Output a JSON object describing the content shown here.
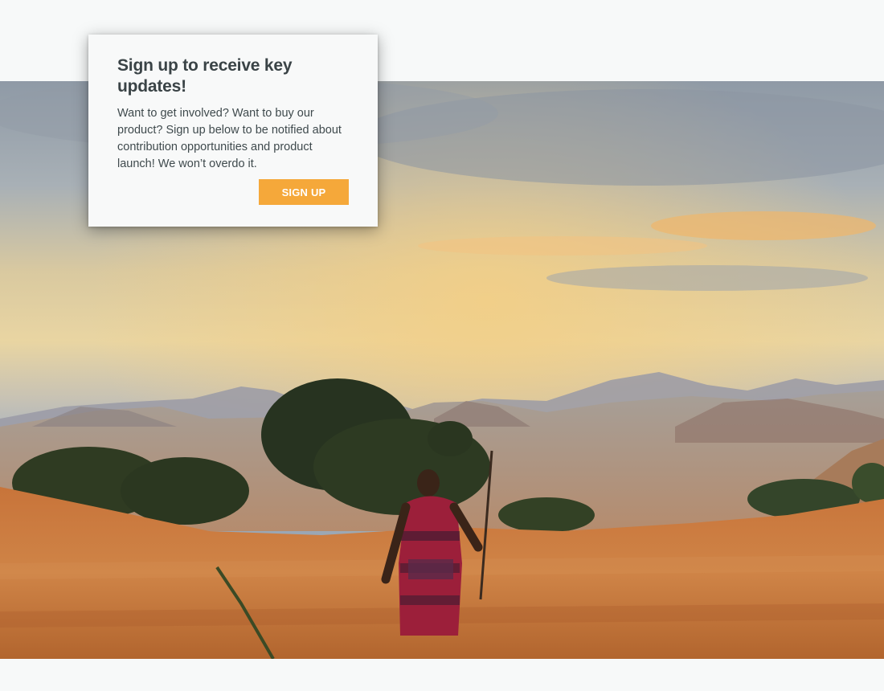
{
  "signup_card": {
    "title": "Sign up to receive key updates!",
    "body": "Want to get involved? Want to buy our product? Sign up below to be notified about contribution opportunities and product launch! We won’t overdo it.",
    "button_label": "SIGN UP"
  },
  "colors": {
    "page_background": "#f7f9f9",
    "button": "#f5a83a",
    "title_text": "#3a4346"
  }
}
